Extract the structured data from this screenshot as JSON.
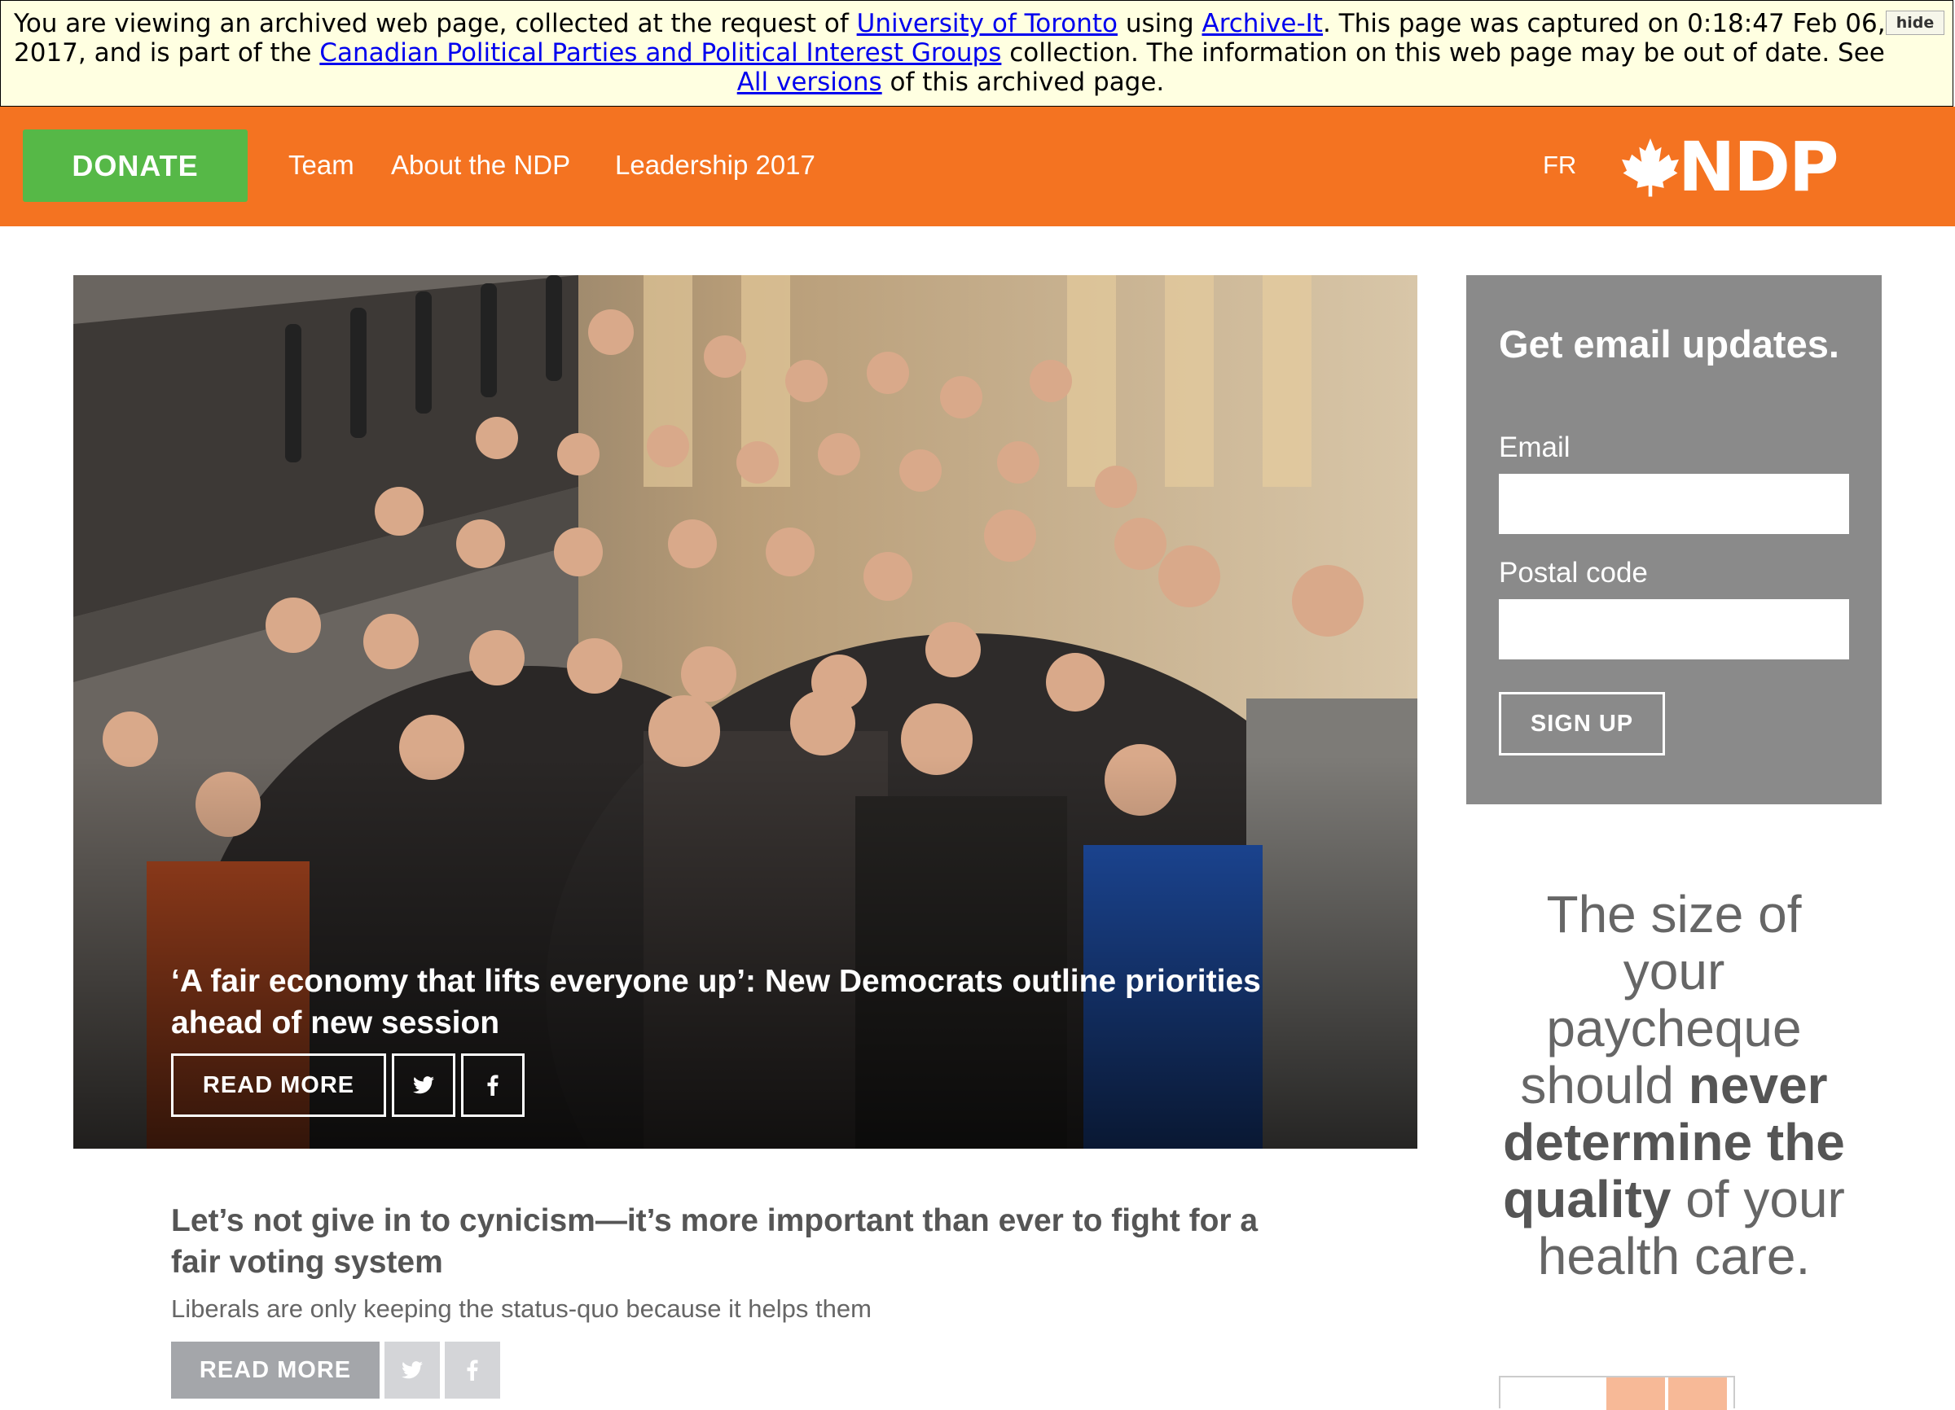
{
  "archive_banner": {
    "text_1": "You are viewing an archived web page, collected at the request of ",
    "link_institution": "University of Toronto",
    "text_2": " using ",
    "link_archive_it": "Archive-It",
    "text_3": ". This page was captured on 0:18:47 Feb 06, 2017, and is part of the ",
    "link_collection": "Canadian Political Parties and Political Interest Groups",
    "text_4": " collection. The information on this web page may be out of date. See ",
    "link_all_versions": "All versions",
    "text_5": " of this archived page.",
    "hide_label": "hide"
  },
  "nav": {
    "donate_label": "DONATE",
    "links": [
      "Team",
      "About the NDP",
      "Leadership 2017"
    ],
    "lang_label": "FR",
    "logo_text": "NDP"
  },
  "hero": {
    "title": "‘A fair economy that lifts everyone up’: New Democrats outline priorities ahead of new session",
    "read_more_label": "READ MORE",
    "twitter_icon": "twitter-icon",
    "facebook_icon": "facebook-icon"
  },
  "article": {
    "title": "Let’s not give in to cynicism—it’s more important than ever to fight for a fair voting system",
    "subtitle": "Liberals are only keeping the status-quo because it helps them",
    "read_more_label": "READ MORE"
  },
  "signup": {
    "title": "Get email updates.",
    "email_label": "Email",
    "postal_label": "Postal code",
    "email_value": "",
    "postal_value": "",
    "button_label": "SIGN UP"
  },
  "quote": {
    "part_1": "The size of your paycheque should ",
    "bold_1": "never determine the quality",
    "part_2": " of your health care."
  },
  "colors": {
    "brand_orange": "#f47321",
    "donate_green": "#56b847",
    "signup_gray": "#8a8a8a",
    "archive_bg": "#ffffe1"
  }
}
